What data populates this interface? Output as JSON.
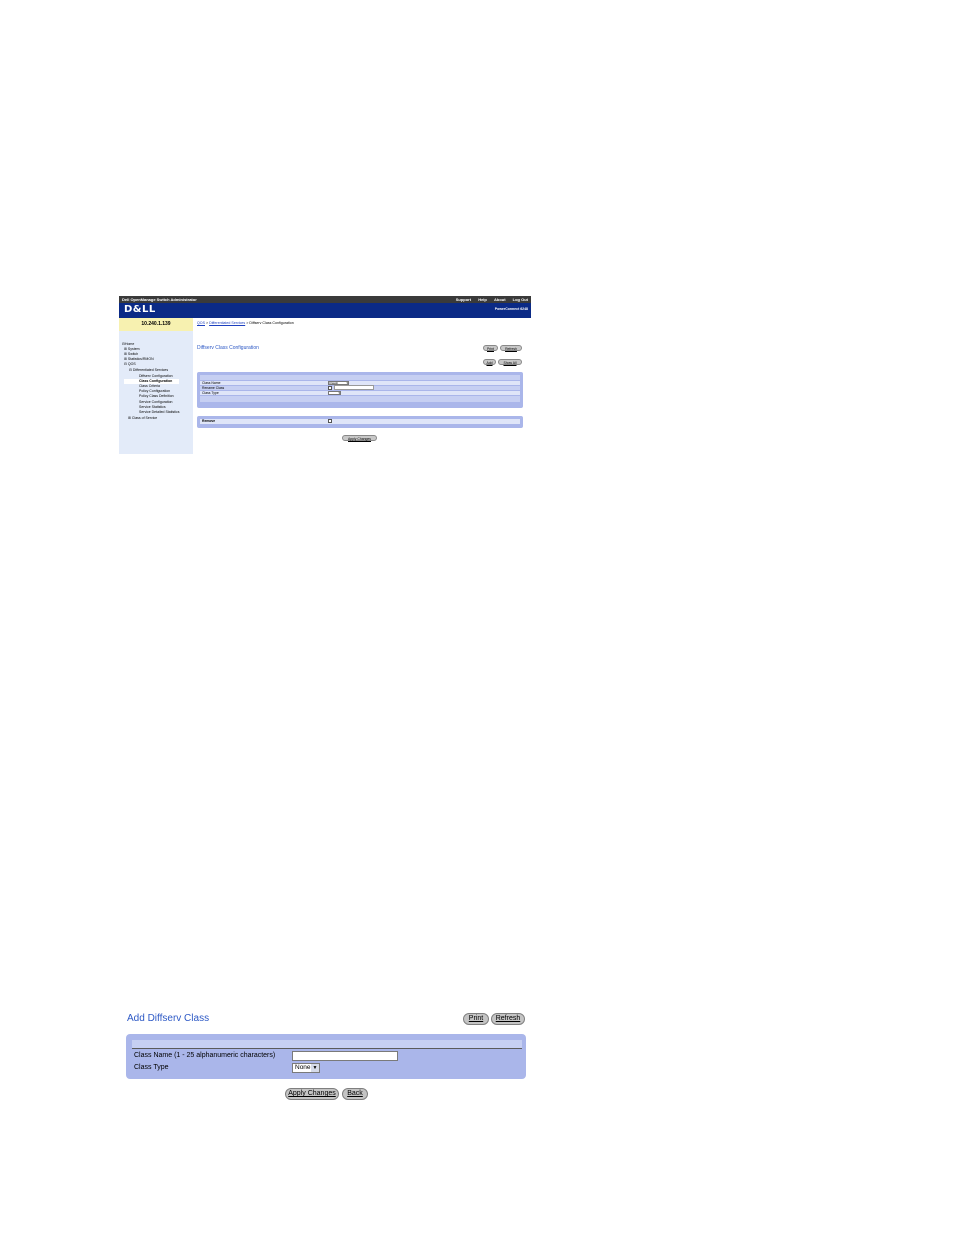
{
  "top_screenshot": {
    "header": {
      "app_title": "Dell OpenManage Switch Administrator",
      "links": [
        "Support",
        "Help",
        "About",
        "Log Out"
      ],
      "logo": "D&LL",
      "model": "PowerConnect 6248"
    },
    "ip_address": "10.240.1.139",
    "breadcrumb": {
      "item1": "QOS",
      "sep1": " > ",
      "item2": "Differentiated Services",
      "sep2": " > ",
      "current": "Diffserv Class Configuration"
    },
    "nav": [
      {
        "label": "Home",
        "prefix": "⊟"
      },
      {
        "label": "System",
        "prefix": "⊞"
      },
      {
        "label": "Switch",
        "prefix": "⊞"
      },
      {
        "label": "Statistics/RMON",
        "prefix": "⊞"
      },
      {
        "label": "QOS",
        "prefix": "⊟"
      },
      {
        "label": "Differentiated Services",
        "prefix": "⊟"
      },
      {
        "label": "Diffserv Configuration",
        "prefix": ""
      },
      {
        "label": "Class Configuration",
        "prefix": ""
      },
      {
        "label": "Class Criteria",
        "prefix": ""
      },
      {
        "label": "Policy Configuration",
        "prefix": ""
      },
      {
        "label": "Policy Class Definition",
        "prefix": ""
      },
      {
        "label": "Service Configuration",
        "prefix": ""
      },
      {
        "label": "Service Statistics",
        "prefix": ""
      },
      {
        "label": "Service Detailed Statistics",
        "prefix": ""
      },
      {
        "label": "Class of Service",
        "prefix": "⊞"
      }
    ],
    "page_title": "Diffserv Class Configuration",
    "buttons": {
      "print": "Print",
      "refresh": "Refresh",
      "add": "Add",
      "show_all": "Show All",
      "apply": "Apply Changes"
    },
    "form": {
      "class_name_label": "Class Name",
      "class_name_value": "Classb",
      "rename_class_label": "Rename Class",
      "class_type_label": "Class Type",
      "remove_label": "Remove"
    }
  },
  "bottom_screenshot": {
    "page_title": "Add Diffserv Class",
    "buttons": {
      "print": "Print",
      "refresh": "Refresh",
      "apply": "Apply Changes",
      "back": "Back"
    },
    "form": {
      "class_name_label": "Class Name (1 - 25 alphanumeric characters)",
      "class_name_value": "",
      "class_type_label": "Class Type",
      "class_type_value": "None"
    }
  }
}
